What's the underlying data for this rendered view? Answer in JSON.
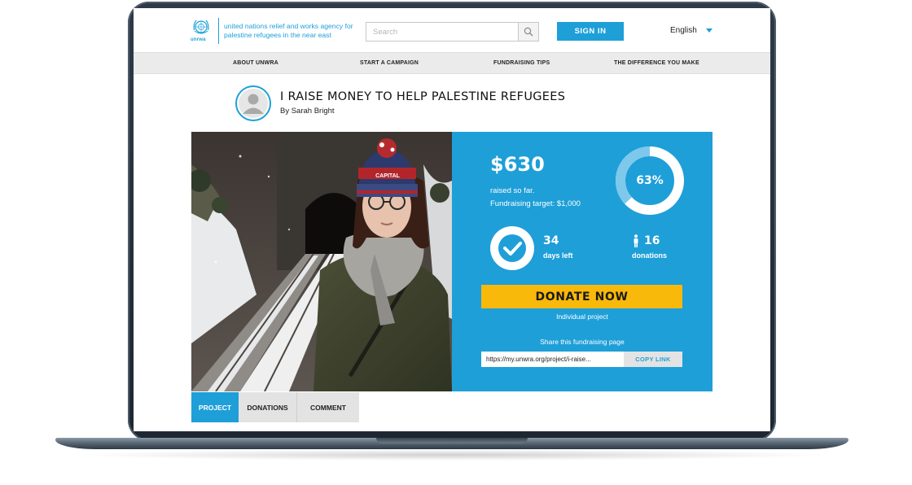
{
  "header": {
    "logo_word": "unrwa",
    "logo_text": "united nations relief and works agency for palestine refugees in the near east",
    "search_placeholder": "Search",
    "signin_label": "SIGN IN",
    "language": "English"
  },
  "nav": {
    "items": [
      {
        "label": "ABOUT UNWRA"
      },
      {
        "label": "START A CAMPAIGN"
      },
      {
        "label": "FUNDRAISING TIPS"
      },
      {
        "label": "THE DIFFERENCE YOU MAKE"
      }
    ]
  },
  "campaign": {
    "title": "I RAISE MONEY TO HELP PALESTINE REFUGEES",
    "author": "By Sarah Bright",
    "photo_hat_text": "CAPITAL",
    "amount_raised": "$630",
    "raised_label": "raised so far.",
    "target_label": "Fundraising target: $1,000",
    "progress_pct_label": "63%",
    "progress_fraction": 0.63,
    "days_left": "34",
    "days_left_label": "days left",
    "donations_count": "16",
    "donations_label": "donations",
    "donate_label": "DONATE NOW",
    "project_type": "Individual project",
    "share_label": "Share this fundraising page",
    "share_link": "https://my.unwra.org/project/i-raise...",
    "copy_label": "COPY LINK"
  },
  "tabs": [
    {
      "label": "PROJECT",
      "active": true
    },
    {
      "label": "DONATIONS",
      "active": false
    },
    {
      "label": "COMMENT",
      "active": false
    }
  ],
  "colors": {
    "brand_blue": "#1e9fd8",
    "donate_yellow": "#f9b90a",
    "nav_gray": "#ebebeb"
  },
  "icons": [
    "un-emblem-icon",
    "search-icon",
    "caret-down-icon",
    "user-avatar-icon",
    "check-icon",
    "person-icon"
  ]
}
